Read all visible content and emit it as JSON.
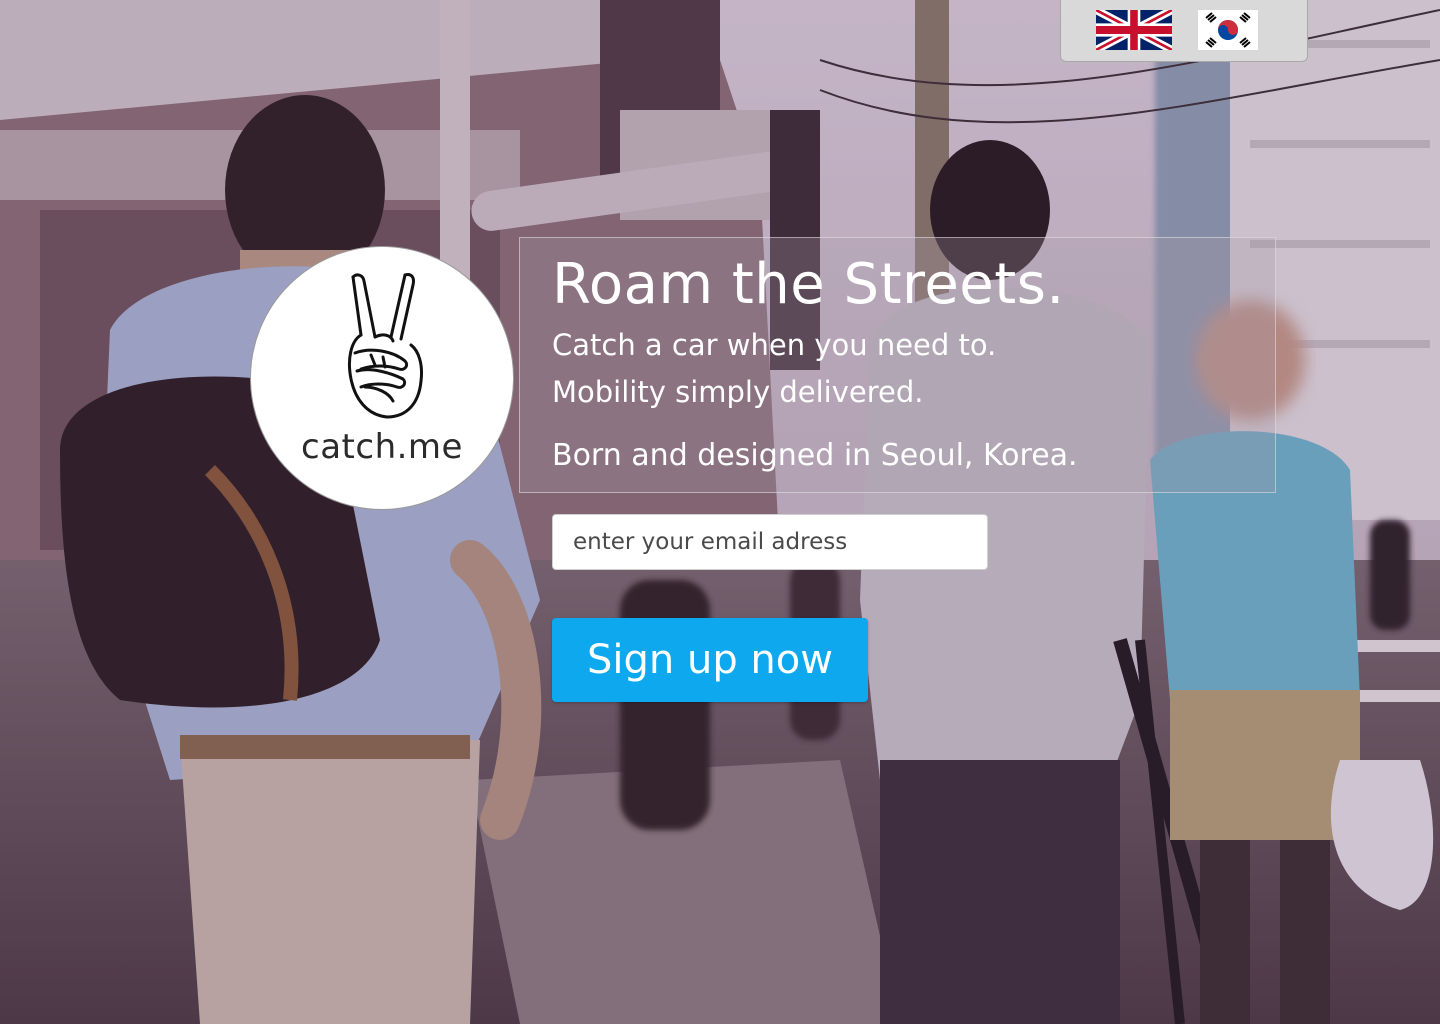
{
  "language_switcher": {
    "options": [
      {
        "label": "English",
        "icon": "uk-flag-icon"
      },
      {
        "label": "Korean",
        "icon": "kr-flag-icon"
      }
    ]
  },
  "logo": {
    "icon": "peace-hand-icon",
    "text": "catch.me"
  },
  "hero": {
    "title": "Roam the Streets.",
    "line1": "Catch a car when you need to.",
    "line2": "Mobility simply delivered.",
    "line3": "Born and designed in Seoul, Korea."
  },
  "signup": {
    "email_placeholder": "enter your email adress",
    "email_value": "",
    "button_label": "Sign up now"
  },
  "colors": {
    "button": "#0ea8ee",
    "panel_text": "#ffffff"
  }
}
